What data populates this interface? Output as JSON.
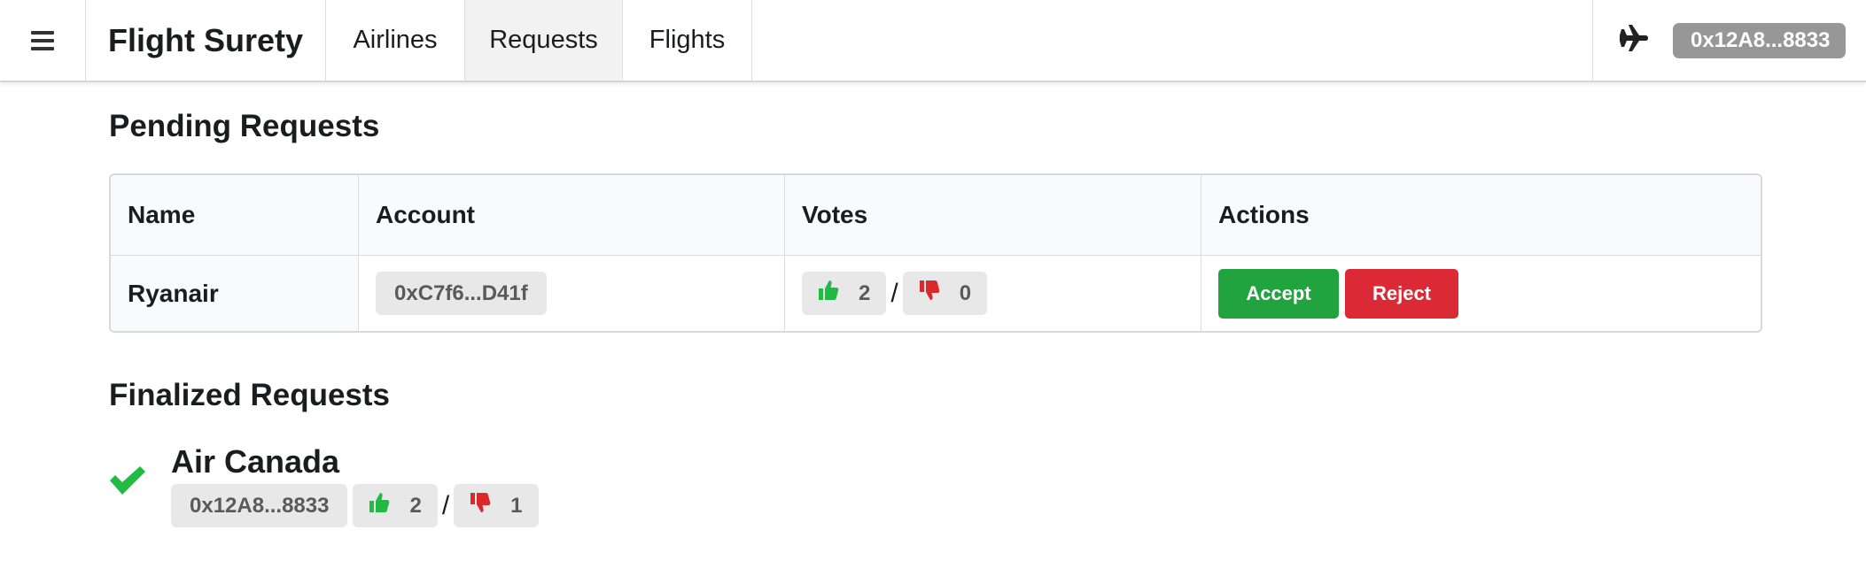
{
  "app": {
    "title": "Flight Surety",
    "nav": [
      "Airlines",
      "Requests",
      "Flights"
    ],
    "active_nav": "Requests",
    "account": "0x12A8...8833"
  },
  "pending": {
    "heading": "Pending Requests",
    "columns": [
      "Name",
      "Account",
      "Votes",
      "Actions"
    ],
    "rows": [
      {
        "name": "Ryanair",
        "account": "0xC7f6...D41f",
        "votes_up": "2",
        "votes_down": "0",
        "separator": "/",
        "accept_label": "Accept",
        "reject_label": "Reject"
      }
    ]
  },
  "finalized": {
    "heading": "Finalized Requests",
    "items": [
      {
        "name": "Air Canada",
        "account": "0x12A8...8833",
        "votes_up": "2",
        "votes_down": "1",
        "separator": "/",
        "status": "approved"
      }
    ]
  },
  "colors": {
    "accept": "#21a340",
    "reject": "#db2a35",
    "thumbs_up": "#21ba45",
    "thumbs_down": "#db2828",
    "check": "#21ba45"
  },
  "icons": [
    "hamburger-icon",
    "plane-icon",
    "thumbs-up-icon",
    "thumbs-down-icon",
    "checkmark-icon"
  ]
}
